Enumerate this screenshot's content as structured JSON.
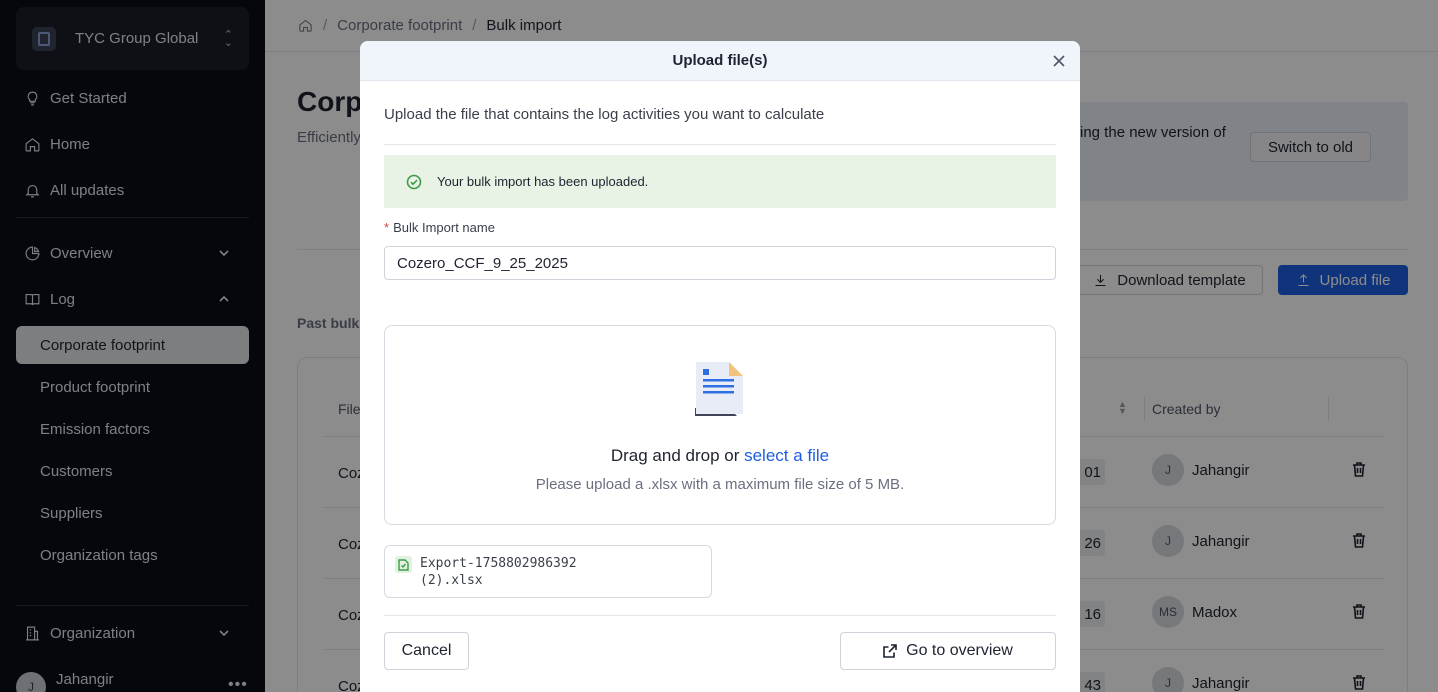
{
  "sidebar": {
    "org_name": "TYC Group Global",
    "nav": {
      "get_started": "Get Started",
      "home": "Home",
      "all_updates": "All updates",
      "overview": "Overview",
      "log": "Log",
      "organization": "Organization"
    },
    "log_items": [
      "Corporate footprint",
      "Product footprint",
      "Emission factors",
      "Customers",
      "Suppliers",
      "Organization tags"
    ],
    "user": {
      "initial": "J",
      "name": "Jahangir",
      "more": "•••"
    }
  },
  "breadcrumb": {
    "sep": "/",
    "parent": "Corporate footprint",
    "current": "Bulk import"
  },
  "page": {
    "title_partial": "Corp",
    "subtitle_partial": "Efficiently",
    "banner_text": "ing the new version of",
    "switch_label": "Switch to old",
    "download_label": "Download template",
    "upload_label": "Upload file",
    "past_label": "Past bulk"
  },
  "table": {
    "col_file": "File",
    "col_created": "Created by",
    "rows": [
      {
        "file": "Coz",
        "chip": "01",
        "initials": "J",
        "name": "Jahangir"
      },
      {
        "file": "Coz",
        "chip": "26",
        "initials": "J",
        "name": "Jahangir"
      },
      {
        "file": "Coz",
        "chip": "16",
        "initials": "MS",
        "name": "Madox"
      },
      {
        "file": "Coz",
        "chip": "43",
        "initials": "J",
        "name": "Jahangir"
      }
    ]
  },
  "modal": {
    "title": "Upload file(s)",
    "description": "Upload the file that contains the log activities you want to calculate",
    "success": "Your bulk import has been uploaded.",
    "field_label": "Bulk Import name",
    "field_required": "*",
    "field_value": "Cozero_CCF_9_25_2025",
    "drop_text": "Drag and drop or ",
    "drop_link": "select a file",
    "drop_hint": "Please upload a .xlsx with a maximum file size of 5 MB.",
    "file_name_line1": "Export-1758802986392",
    "file_name_line2": "(2).xlsx",
    "cancel": "Cancel",
    "go_overview": "Go to overview"
  },
  "colors": {
    "primary": "#1e5fe0",
    "success_bg": "#e8f3e5",
    "success_icon": "#3d9b4a",
    "sidebar_bg": "#0b0e17"
  }
}
